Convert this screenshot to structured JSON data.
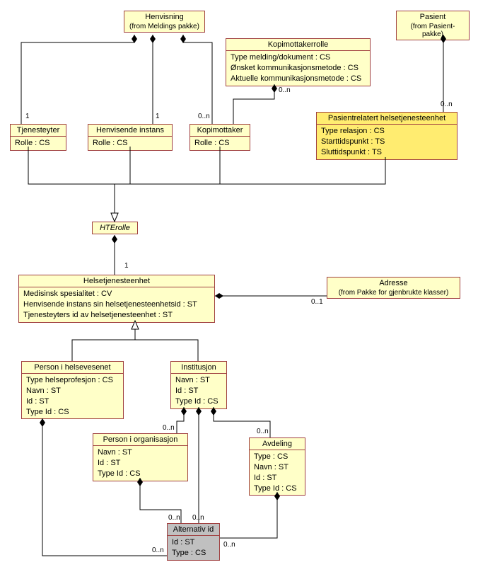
{
  "classes": {
    "henvisning": {
      "title": "Henvisning",
      "sub": "(from Meldings pakke)"
    },
    "kopimottakerrolle": {
      "title": "Kopimottakerrolle",
      "attrs": [
        "Type melding/dokument : CS",
        "Ønsket kommunikasjonsmetode : CS",
        "Aktuelle kommunikasjonsmetode : CS"
      ]
    },
    "pasient": {
      "title": "Pasient",
      "sub": "(from Pasient-pakke)"
    },
    "tjenesteyter": {
      "title": "Tjenesteyter",
      "attrs": [
        "Rolle : CS"
      ]
    },
    "henvisende_instans": {
      "title": "Henvisende instans",
      "attrs": [
        "Rolle : CS"
      ]
    },
    "kopimottaker": {
      "title": "Kopimottaker",
      "attrs": [
        "Rolle : CS"
      ]
    },
    "pasientrelatert": {
      "title": "Pasientrelatert helsetjenesteenhet",
      "attrs": [
        "Type relasjon : CS",
        "Starttidspunkt : TS",
        "Sluttidspunkt : TS"
      ]
    },
    "hterolle": {
      "title": "HTErolle"
    },
    "helsetjenesteenhet": {
      "title": "Helsetjenesteenhet",
      "attrs": [
        "Medisinsk spesialitet : CV",
        "Henvisende instans sin helsetjenesteenhetsid : ST",
        "Tjenesteyters id av helsetjenesteenhet : ST"
      ]
    },
    "adresse": {
      "title": "Adresse",
      "sub": "(from Pakke for gjenbrukte klasser)"
    },
    "person_helsevesenet": {
      "title": "Person i helsevesenet",
      "attrs": [
        "Type helseprofesjon : CS",
        "Navn : ST",
        "Id : ST",
        "Type Id : CS"
      ]
    },
    "institusjon": {
      "title": "Institusjon",
      "attrs": [
        "Navn : ST",
        "Id : ST",
        "Type Id : CS"
      ]
    },
    "person_organisasjon": {
      "title": "Person i organisasjon",
      "attrs": [
        "Navn : ST",
        "Id : ST",
        "Type Id : CS"
      ]
    },
    "avdeling": {
      "title": "Avdeling",
      "attrs": [
        "Type : CS",
        "Navn : ST",
        "Id : ST",
        "Type Id : CS"
      ]
    },
    "alternativ_id": {
      "title": "Alternativ id",
      "attrs": [
        "Id : ST",
        "Type : CS"
      ]
    }
  },
  "mults": {
    "m1a": "1",
    "m1b": "1",
    "m0n1": "0..n",
    "m0n2": "0..n",
    "m0n3": "0..n",
    "m1c": "1",
    "m01": "0..1",
    "m0n4": "0..n",
    "m0n5": "0..n",
    "m0n6": "0..n",
    "m0n7": "0..n",
    "m0n8": "0..n",
    "m0n9": "0..n"
  }
}
